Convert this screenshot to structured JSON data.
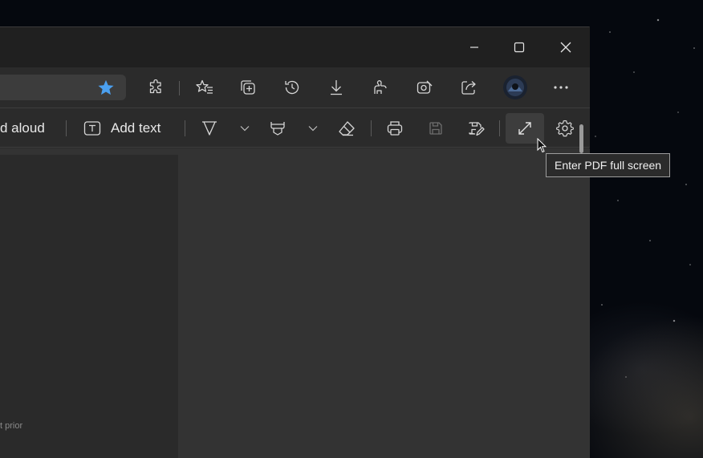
{
  "window_controls": {
    "minimize": "minimize-icon",
    "maximize": "maximize-icon",
    "close": "close-icon"
  },
  "toolbar": {
    "favorite_star_color": "#4ba0f0",
    "icons": [
      "favorite-star-icon",
      "extensions-icon",
      "favorites-icon",
      "collections-icon",
      "history-icon",
      "downloads-icon",
      "performance-icon",
      "web-capture-icon",
      "share-icon",
      "profile-avatar",
      "more-icon"
    ]
  },
  "pdf_toolbar": {
    "read_aloud_label": "d aloud",
    "add_text_label": "Add text",
    "icons": [
      "draw-icon",
      "highlight-icon",
      "erase-icon",
      "print-icon",
      "save-icon",
      "save-as-icon",
      "fullscreen-icon",
      "settings-icon"
    ]
  },
  "tooltip": {
    "text": "Enter PDF full screen"
  },
  "document": {
    "visible_text": "t prior"
  }
}
